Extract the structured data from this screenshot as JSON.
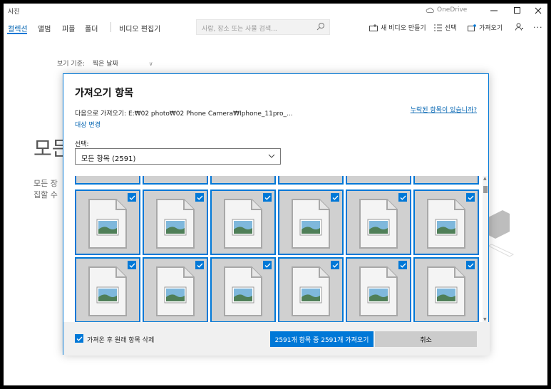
{
  "app": {
    "title": "사진",
    "onedrive_label": "OneDrive"
  },
  "nav": {
    "tabs": [
      {
        "label": "컬렉션",
        "active": true
      },
      {
        "label": "앨범"
      },
      {
        "label": "피플"
      },
      {
        "label": "폴더"
      },
      {
        "label": "비디오 편집기"
      }
    ],
    "search_placeholder": "사람, 장소 또는 사물 검색...",
    "actions": [
      {
        "label": "새 비디오 만들기",
        "icon": "video-plus-icon"
      },
      {
        "label": "선택",
        "icon": "select-list-icon"
      },
      {
        "label": "가져오기",
        "icon": "import-icon"
      }
    ]
  },
  "background": {
    "view_by_label": "보기 기준:",
    "view_by_value": "찍은 날짜",
    "heading_fragment": "모든",
    "desc_line1": "모든 장",
    "desc_line2": "집할 수"
  },
  "dialog": {
    "title": "가져오기 항목",
    "dest_label": "다음으로 가져오기: E:₩02 photo₩02 Phone Camera₩Iphone_11pro_...",
    "change_dest_link": "대상 변경",
    "missing_link": "누락된 항목이 있습니까?",
    "select_label": "선택:",
    "select_value": "모든 항목 (2591)",
    "delete_checkbox_label": "가져온 후 원래 항목 삭제",
    "delete_checked": true,
    "import_button": "2591개 항목 중 2591개 가져오기",
    "cancel_button": "취소"
  },
  "colors": {
    "accent": "#0078d7",
    "link": "#0063b1",
    "tile_bg": "#d0d0d0",
    "footer_bg": "#f0f0f0"
  }
}
